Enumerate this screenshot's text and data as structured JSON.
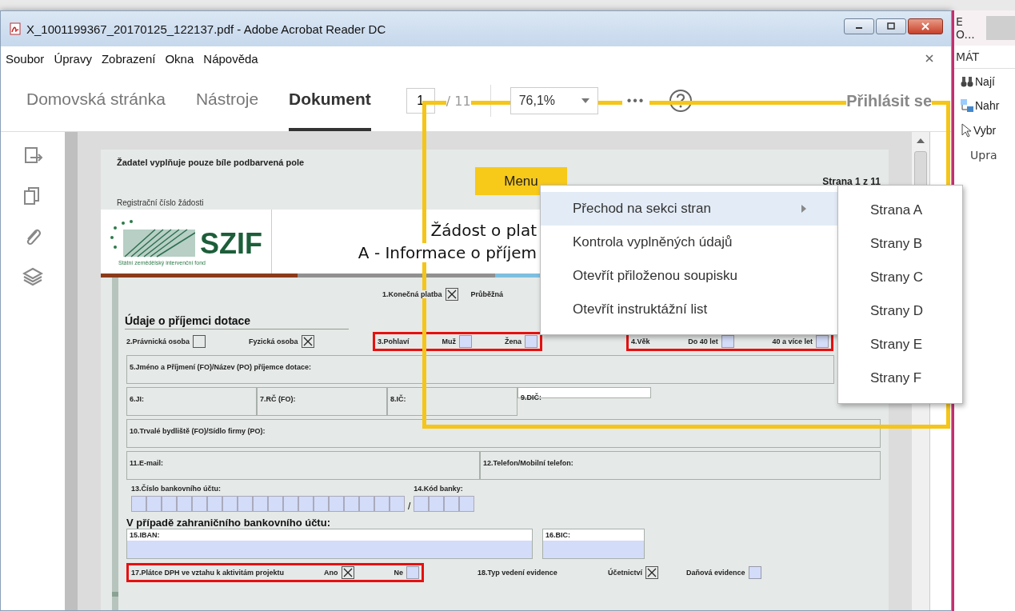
{
  "window": {
    "title": "X_1001199367_20170125_122137.pdf - Adobe Acrobat Reader DC"
  },
  "menu_bar": [
    "Soubor",
    "Úpravy",
    "Zobrazení",
    "Okna",
    "Nápověda"
  ],
  "tabs": [
    {
      "label": "Domovská stránka",
      "selected": false
    },
    {
      "label": "Nástroje",
      "selected": false
    },
    {
      "label": "Dokument",
      "selected": true
    }
  ],
  "page_nav": {
    "current": "1",
    "total": "/ 11"
  },
  "zoom": "76,1%",
  "more": "•••",
  "sign_in": "Přihlásit se",
  "document": {
    "note": "Žadatel vyplňuje pouze bíle podbarvená pole",
    "menu_button": "Menu",
    "page_label": "Strana 1 z 11",
    "registration_label": "Registrační číslo žádosti",
    "logo": {
      "text": "SZIF",
      "subtitle": "Státní zemědělský intervenční fond"
    },
    "title_lines": [
      "Žádost o plat",
      "A - Informace o příjem"
    ],
    "payment": [
      {
        "kind": "option",
        "label": "1.Konečná platba",
        "checked": true,
        "fillable": false
      },
      {
        "kind": "label",
        "label": "Průběžná"
      }
    ],
    "section_title": "Údaje o příjemci dotace",
    "row_2": [
      {
        "kind": "option",
        "label": "2.Právnická osoba",
        "checked": false,
        "fillable": false
      },
      {
        "kind": "option",
        "label": "Fyzická osoba",
        "checked": true,
        "fillable": false
      },
      {
        "kind": "group",
        "flagged": true,
        "label": "3.Pohlaví",
        "options": [
          {
            "label": "Muž",
            "checked": false,
            "fillable": true
          },
          {
            "label": "Žena",
            "checked": false,
            "fillable": true
          }
        ]
      },
      {
        "kind": "group",
        "flagged": true,
        "label": "4.Věk",
        "options": [
          {
            "label": "Do 40 let",
            "checked": false,
            "fillable": true
          },
          {
            "label": "40 a více let",
            "checked": false,
            "fillable": true
          }
        ]
      }
    ],
    "field_rows": [
      [
        {
          "label": "5.Jméno a Příjmení (FO)/Název (PO) příjemce dotace:",
          "fillable": false
        }
      ],
      [
        {
          "label": "6.JI:",
          "fillable": false
        },
        {
          "label": "7.RČ (FO):",
          "fillable": false
        },
        {
          "label": "8.IČ:",
          "fillable": false
        },
        {
          "label": "9.DIČ:",
          "fillable": true
        }
      ],
      [
        {
          "label": "10.Trvalé bydliště (FO)/Sídlo firmy (PO):",
          "fillable": false
        }
      ],
      [
        {
          "label": "11.E-mail:",
          "fillable": false
        },
        {
          "label": "12.Telefon/Mobilní telefon:",
          "fillable": false
        }
      ]
    ],
    "bank": {
      "account_label": "13.Číslo bankovního účtu:",
      "code_label": "14.Kód banky:",
      "separator": "/"
    },
    "foreign_heading": "V případě zahraničního bankovního účtu:",
    "foreign_fields": [
      {
        "label": "15.IBAN:",
        "fillable": true
      },
      {
        "label": "16.BIC:",
        "fillable": true
      }
    ],
    "row_17": [
      {
        "kind": "group",
        "flagged": true,
        "label": "17.Plátce DPH ve vztahu k aktivitám projektu",
        "options": [
          {
            "label": "Ano",
            "checked": true,
            "fillable": false
          },
          {
            "label": "Ne",
            "checked": false,
            "fillable": true
          }
        ]
      },
      {
        "kind": "label",
        "label": "18.Typ vedení evidence"
      },
      {
        "kind": "option",
        "label": "Účetnictví",
        "checked": true,
        "fillable": false
      },
      {
        "kind": "option",
        "label": "Daňová evidence",
        "checked": false,
        "fillable": true
      }
    ]
  },
  "context_menu": {
    "items": [
      {
        "label": "Přechod na sekci stran",
        "selected": true,
        "has_submenu": true
      },
      {
        "label": "Kontrola vyplněných údajů",
        "selected": false,
        "has_submenu": false
      },
      {
        "label": "Otevřít přiloženou soupisku",
        "selected": false,
        "has_submenu": false
      },
      {
        "label": "Otevřít instruktážní list",
        "selected": false,
        "has_submenu": false
      }
    ],
    "submenu": [
      "Strana A",
      "Strany B",
      "Strany C",
      "Strany D",
      "Strany E",
      "Strany F"
    ]
  },
  "side_window": {
    "title": "E O...",
    "ribbon_tab": "MÁT",
    "commands": [
      {
        "kind": "find",
        "label": "Nají"
      },
      {
        "kind": "replace",
        "label": "Nahr"
      },
      {
        "kind": "select",
        "label": "Vybr"
      }
    ],
    "group_label": "Upra"
  }
}
